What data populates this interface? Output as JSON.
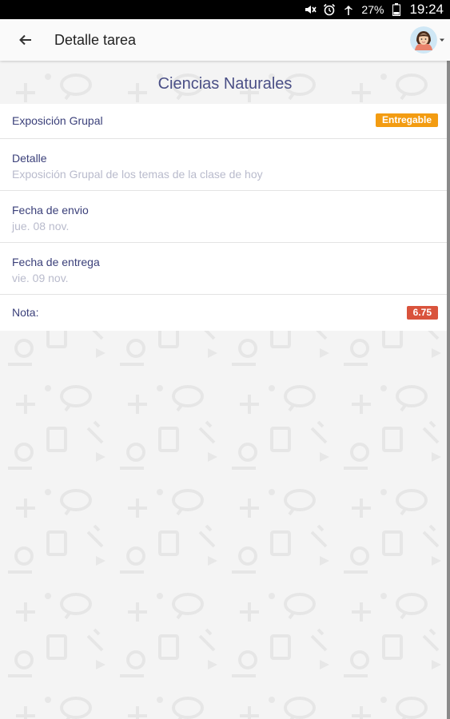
{
  "status_bar": {
    "battery": "27%",
    "time": "19:24",
    "icons": [
      "mute-icon",
      "alarm-icon",
      "signal-icon",
      "battery-icon"
    ]
  },
  "app_bar": {
    "title": "Detalle tarea",
    "back_icon": "arrow-back-icon",
    "avatar_icon": "user-avatar-icon"
  },
  "subject": "Ciencias Naturales",
  "task": {
    "name": "Exposición Grupal",
    "status_badge": "Entregable",
    "status_color": "#f39c12",
    "detail_label": "Detalle",
    "detail_value": "Exposición Grupal de los temas de la clase de hoy",
    "sent_label": "Fecha de envio",
    "sent_value": "jue. 08 nov.",
    "due_label": "Fecha de entrega",
    "due_value": "vie. 09 nov.",
    "grade_label": "Nota:",
    "grade_value": "6.75",
    "grade_color": "#d9533c"
  }
}
